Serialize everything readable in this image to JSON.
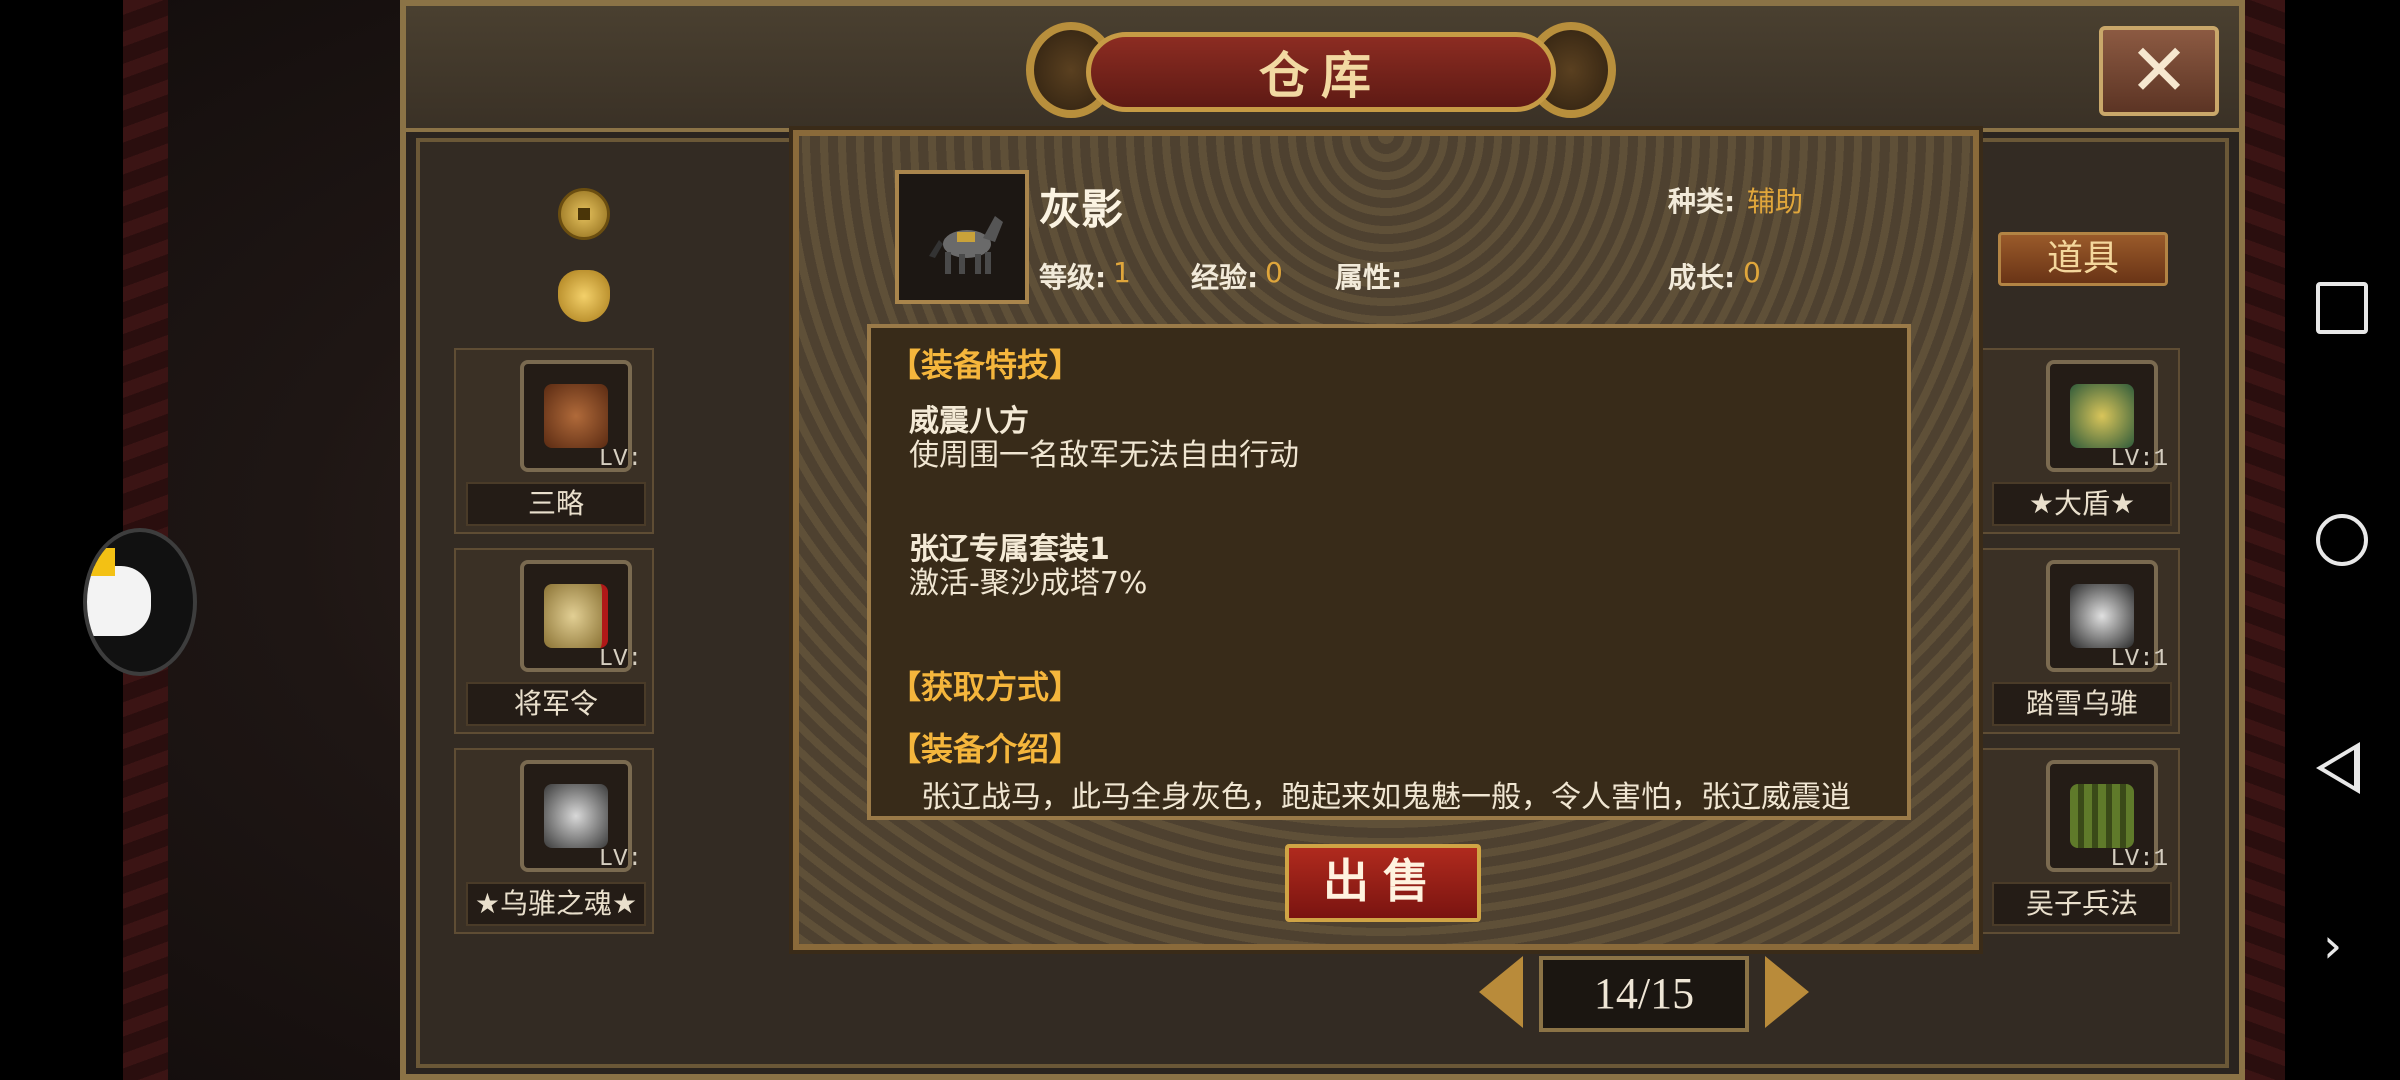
{
  "warehouse": {
    "title": "仓库",
    "tab_items": "道具",
    "close_symbol": "✕",
    "left_items": [
      {
        "name": "三略",
        "lv": "LV:"
      },
      {
        "name": "将军令",
        "lv": "LV:"
      },
      {
        "name": "★乌骓之魂★",
        "lv": "LV:"
      }
    ],
    "right_items": [
      {
        "name": "★大盾★",
        "lv": "LV:1"
      },
      {
        "name": "踏雪乌骓",
        "lv": "LV:1"
      },
      {
        "name": "吴子兵法",
        "lv": "LV:1"
      }
    ],
    "pager": "14/15"
  },
  "detail": {
    "name": "灰影",
    "type_label": "种类:",
    "type_value": "辅助",
    "level_label": "等级:",
    "level_value": "1",
    "exp_label": "经验:",
    "exp_value": "0",
    "attr_label": "属性:",
    "growth_label": "成长:",
    "growth_value": "0",
    "section_skill": "【装备特技】",
    "skill1_name": "威震八方",
    "skill1_desc": "使周围一名敌军无法自由行动",
    "skill2_name": "张辽专属套装1",
    "skill2_desc": "激活-聚沙成塔7%",
    "section_source": "【获取方式】",
    "section_intro": "【装备介绍】",
    "intro_text": "张辽战马，此马全身灰色，跑起来如鬼魅一般，令人害怕，张辽威震逍",
    "sell_label": "出售"
  },
  "android_nav": {
    "more": "›"
  },
  "colors": {
    "accent_gold": "#e0a63b",
    "section_orange": "#f5b63c",
    "title_red": "#8c2c22"
  }
}
